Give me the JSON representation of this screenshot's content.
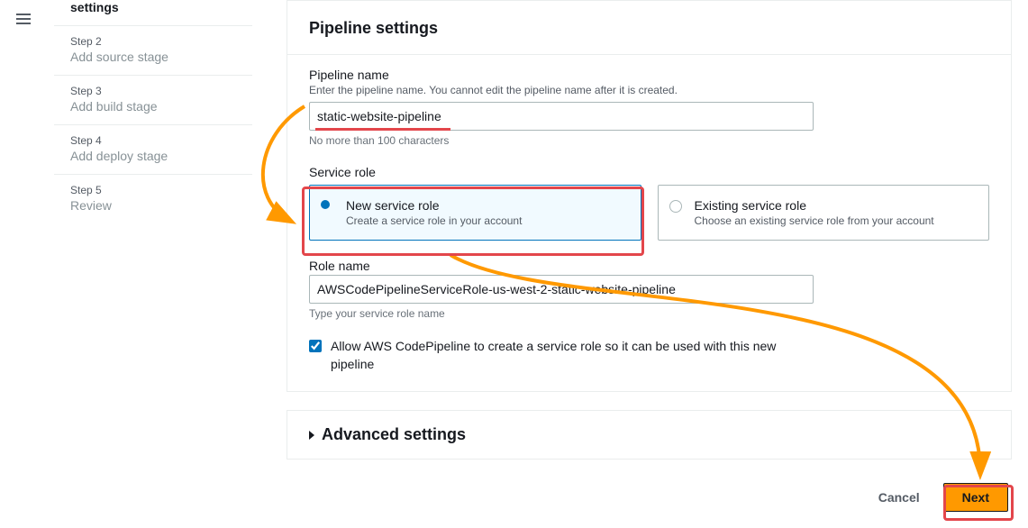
{
  "sidebar": {
    "current": "settings",
    "steps": [
      {
        "num": "Step 2",
        "label": "Add source stage"
      },
      {
        "num": "Step 3",
        "label": "Add build stage"
      },
      {
        "num": "Step 4",
        "label": "Add deploy stage"
      },
      {
        "num": "Step 5",
        "label": "Review"
      }
    ]
  },
  "panel": {
    "title": "Pipeline settings",
    "pipeline_name": {
      "label": "Pipeline name",
      "desc": "Enter the pipeline name. You cannot edit the pipeline name after it is created.",
      "value": "static-website-pipeline",
      "hint": "No more than 100 characters"
    },
    "service_role": {
      "label": "Service role",
      "options": {
        "new": {
          "title": "New service role",
          "desc": "Create a service role in your account"
        },
        "existing": {
          "title": "Existing service role",
          "desc": "Choose an existing service role from your account"
        }
      }
    },
    "role_name": {
      "label": "Role name",
      "value": "AWSCodePipelineServiceRole-us-west-2-static-website-pipeline",
      "hint": "Type your service role name"
    },
    "allow_create": {
      "checked": true,
      "label": "Allow AWS CodePipeline to create a service role so it can be used with this new pipeline"
    }
  },
  "advanced": {
    "title": "Advanced settings"
  },
  "footer": {
    "cancel": "Cancel",
    "next": "Next"
  }
}
